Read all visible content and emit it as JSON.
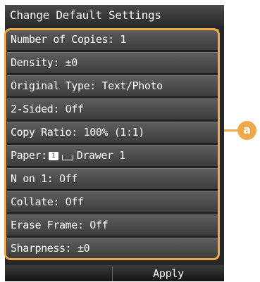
{
  "header": {
    "title": "Change Default Settings"
  },
  "settings": {
    "items": [
      {
        "label": "Number of Copies: 1"
      },
      {
        "label": "Density: ±0"
      },
      {
        "label": "Original Type: Text/Photo"
      },
      {
        "label": "2-Sided: Off"
      },
      {
        "label": "Copy Ratio: 100% (1:1)"
      },
      {
        "prefix": "Paper:",
        "paper_icon": "1",
        "suffix": "Drawer 1"
      },
      {
        "label": "N on 1: Off"
      },
      {
        "label": "Collate: Off"
      },
      {
        "label": "Erase Frame: Off"
      },
      {
        "label": "Sharpness: ±0"
      }
    ]
  },
  "footer": {
    "left_label": "",
    "apply_label": "Apply"
  },
  "callout": {
    "letter": "a",
    "color": "#f0a94a"
  },
  "icons": {
    "paper": "paper-size-icon",
    "drawer": "drawer-icon"
  }
}
